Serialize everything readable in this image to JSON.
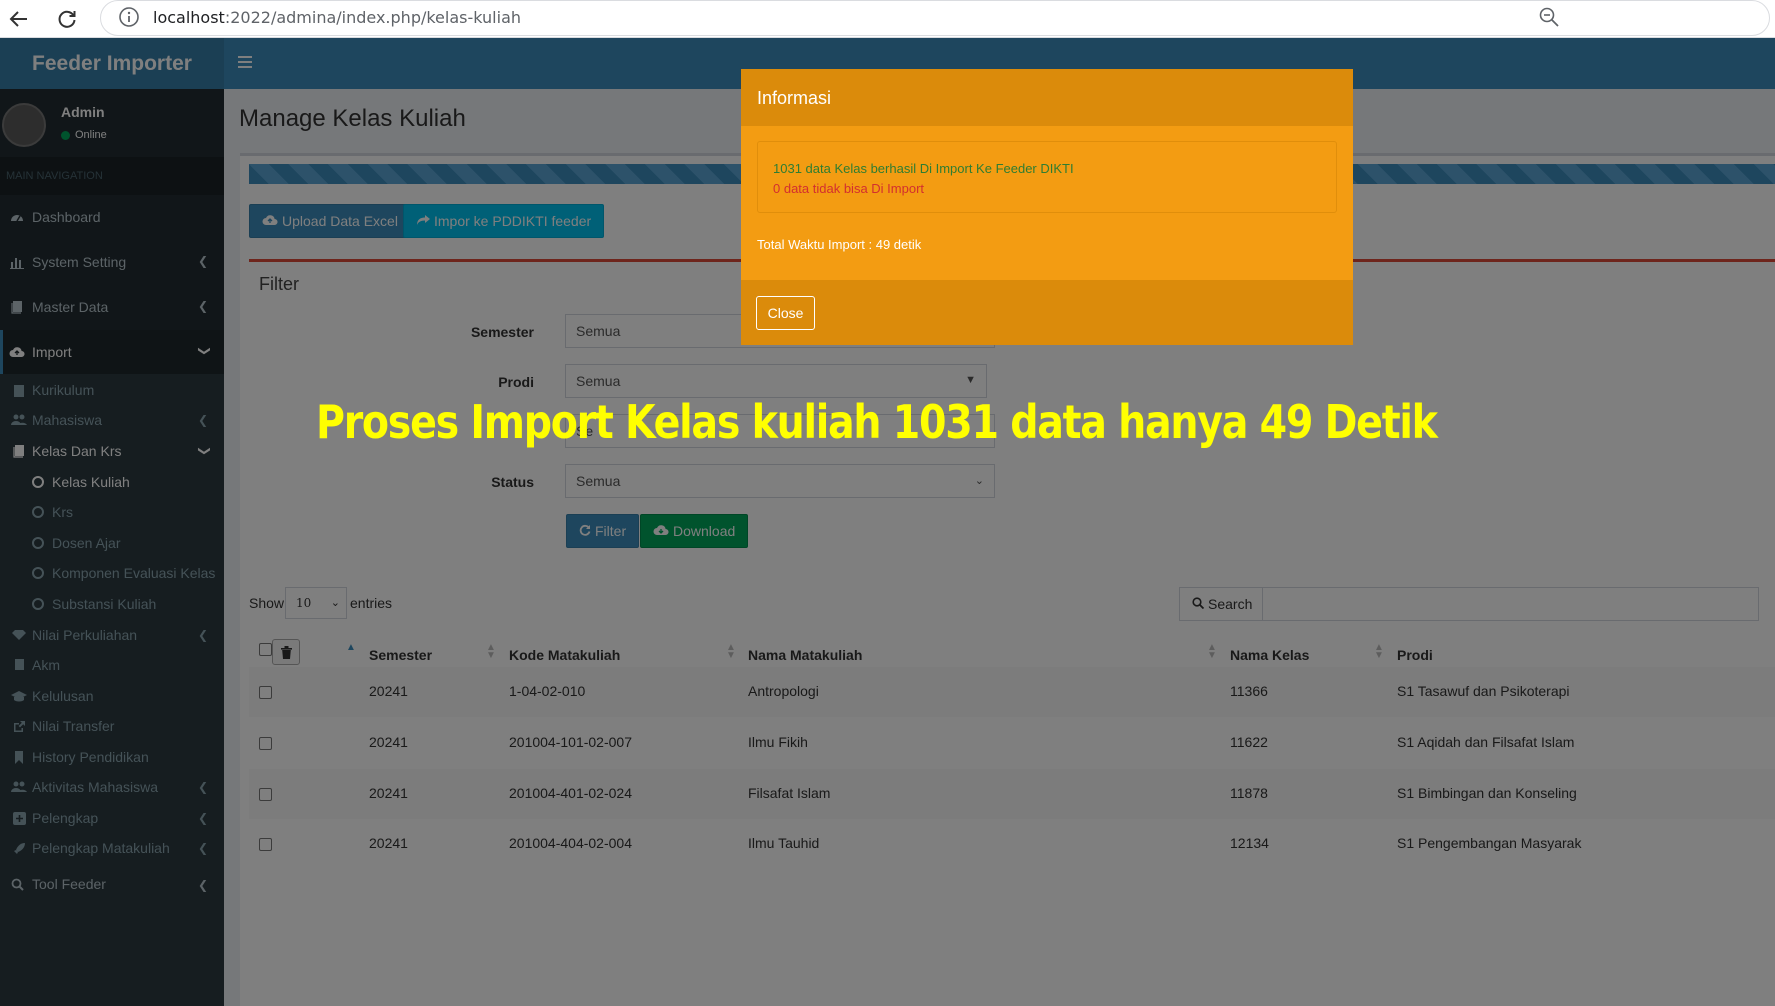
{
  "browser": {
    "url_host": "localhost",
    "url_rest": ":2022/admina/index.php/kelas-kuliah"
  },
  "header": {
    "logo": "Feeder Importer"
  },
  "user": {
    "name": "Admin",
    "status": "Online"
  },
  "sidebar": {
    "nav_header": "MAIN NAVIGATION",
    "top_items": [
      {
        "label": "Dashboard"
      },
      {
        "label": "System Setting"
      },
      {
        "label": "Master Data"
      },
      {
        "label": "Import"
      }
    ],
    "import_sub": [
      {
        "label": "Kurikulum"
      },
      {
        "label": "Mahasiswa"
      },
      {
        "label": "Kelas Dan Krs"
      }
    ],
    "kelas_sub": [
      {
        "label": "Kelas Kuliah"
      },
      {
        "label": "Krs"
      },
      {
        "label": "Dosen Ajar"
      },
      {
        "label": "Komponen Evaluasi Kelas"
      },
      {
        "label": "Substansi Kuliah"
      }
    ],
    "more_items": [
      {
        "label": "Nilai Perkuliahan"
      },
      {
        "label": "Akm"
      },
      {
        "label": "Kelulusan"
      },
      {
        "label": "Nilai Transfer"
      },
      {
        "label": "History Pendidikan"
      },
      {
        "label": "Aktivitas Mahasiswa"
      },
      {
        "label": "Pelengkap"
      },
      {
        "label": "Pelengkap Matakuliah"
      },
      {
        "label": "Tool Feeder"
      }
    ]
  },
  "page": {
    "title": "Manage Kelas Kuliah",
    "upload_btn": "Upload Data Excel",
    "import_btn": "Impor ke PDDIKTI feeder",
    "filter": {
      "title": "Filter",
      "semester_label": "Semester",
      "semester_value": "Semua",
      "prodi_label": "Prodi",
      "prodi_value": "Semua",
      "third_value": "Se",
      "status_label": "Status",
      "status_value": "Semua",
      "filter_btn": "Filter",
      "download_btn": "Download"
    },
    "table": {
      "show_label": "Show",
      "length_value": "10",
      "entries_label": "entries",
      "search_label": "Search",
      "headers": [
        "Semester",
        "Kode Matakuliah",
        "Nama Matakuliah",
        "Nama Kelas",
        "Prodi"
      ],
      "rows": [
        {
          "semester": "20241",
          "kode": "1-04-02-010",
          "nama": "Antropologi",
          "kelas": "11366",
          "prodi": "S1 Tasawuf dan Psikoterapi"
        },
        {
          "semester": "20241",
          "kode": "201004-101-02-007",
          "nama": "Ilmu Fikih",
          "kelas": "11622",
          "prodi": "S1 Aqidah dan Filsafat Islam"
        },
        {
          "semester": "20241",
          "kode": "201004-401-02-024",
          "nama": "Filsafat Islam",
          "kelas": "11878",
          "prodi": "S1 Bimbingan dan Konseling"
        },
        {
          "semester": "20241",
          "kode": "201004-404-02-004",
          "nama": "Ilmu Tauhid",
          "kelas": "12134",
          "prodi": "S1 Pengembangan Masyarak"
        }
      ]
    }
  },
  "modal": {
    "title": "Informasi",
    "success_msg": "1031 data Kelas berhasil Di Import Ke Feeder DIKTI",
    "fail_msg": "0 data tidak bisa Di Import",
    "total_msg": "Total Waktu Import : 49 detik",
    "close_btn": "Close"
  },
  "caption": "Proses Import Kelas kuliah 1031 data hanya 49 Detik",
  "colors": {
    "header": "#3c8dbc",
    "sidebar": "#222d32",
    "modal": "#f39c12",
    "caption": "#ffff00"
  }
}
